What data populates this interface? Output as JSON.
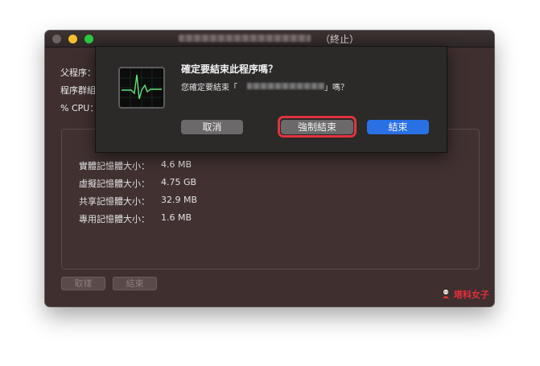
{
  "window": {
    "title_suffix": "（終止）",
    "fields": [
      {
        "label": "父程序："
      },
      {
        "label": "程序群組："
      },
      {
        "label": "% CPU："
      }
    ],
    "memory": [
      {
        "label": "實體記憶體大小：",
        "value": "4.6 MB"
      },
      {
        "label": "虛擬記憶體大小：",
        "value": "4.75 GB"
      },
      {
        "label": "共享記憶體大小：",
        "value": "32.9 MB"
      },
      {
        "label": "專用記憶體大小：",
        "value": "1.6 MB"
      }
    ],
    "bottom_buttons": {
      "sample": "取樣",
      "quit": "結束"
    }
  },
  "dialog": {
    "title": "確定要結束此程序嗎？",
    "message_prefix": "您確定要結束「",
    "message_suffix": "」嗎？",
    "buttons": {
      "cancel": "取消",
      "force_quit": "強制結束",
      "quit": "結束"
    },
    "icon": "activity-monitor-icon"
  },
  "watermark": "塔科女子",
  "colors": {
    "accent": "#2870e4",
    "highlight": "#e0343d",
    "window_bg": "#3f2f2f",
    "dialog_bg": "#2c2929"
  }
}
